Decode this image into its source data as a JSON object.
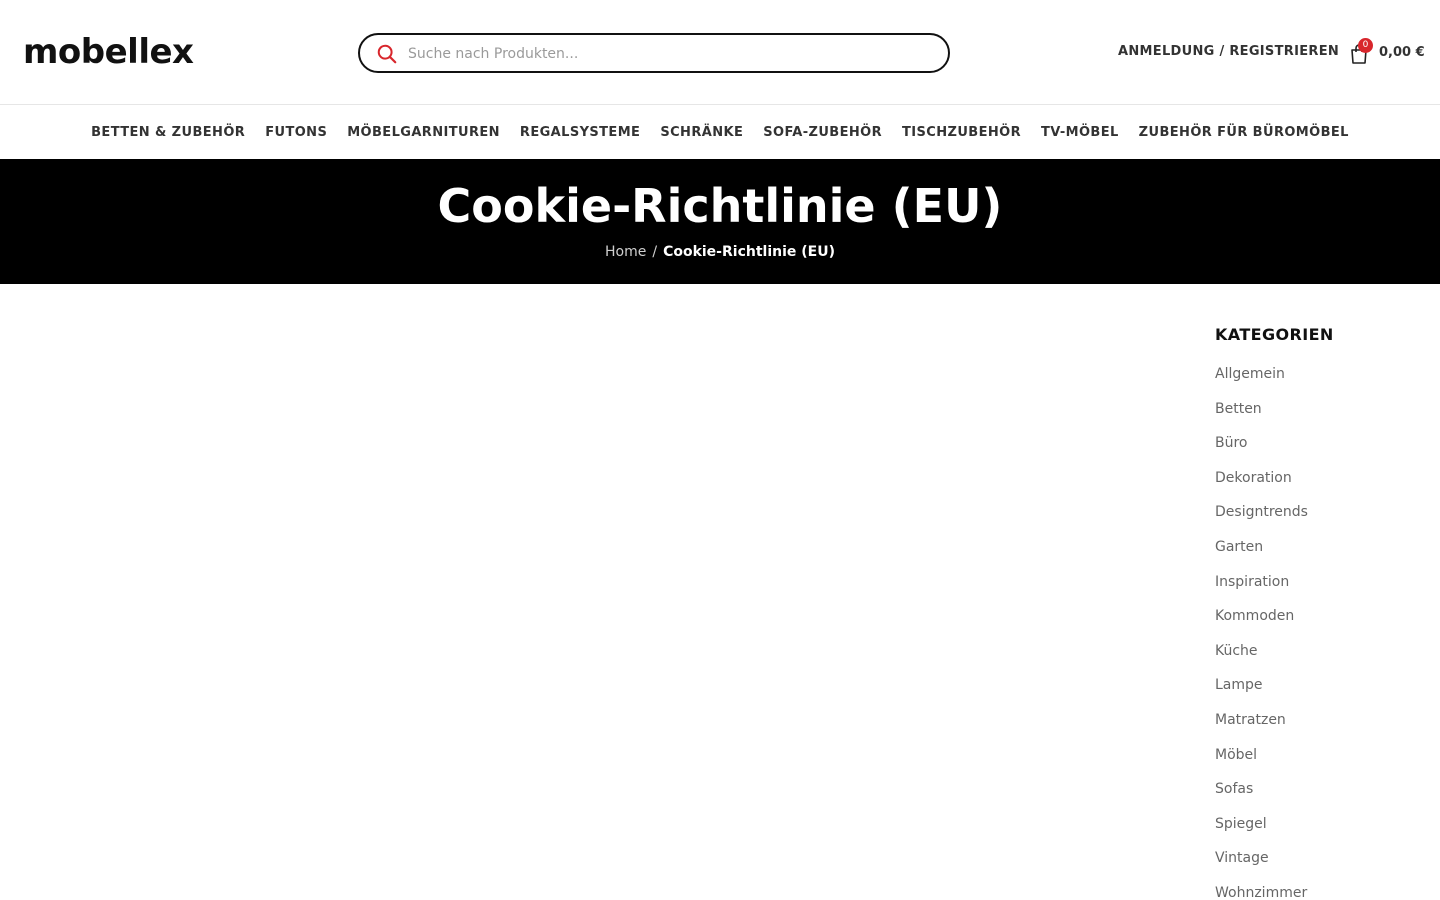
{
  "header": {
    "logo": "mobellex",
    "search_placeholder": "Suche nach Produkten...",
    "login_label": "ANMELDUNG / REGISTRIEREN",
    "cart_count": "0",
    "cart_total": "0,00 €"
  },
  "nav": {
    "items": [
      "BETTEN & ZUBEHÖR",
      "FUTONS",
      "MÖBELGARNITUREN",
      "REGALSYSTEME",
      "SCHRÄNKE",
      "SOFA-ZUBEHÖR",
      "TISCHZUBEHÖR",
      "TV-MÖBEL",
      "ZUBEHÖR FÜR BÜROMÖBEL"
    ]
  },
  "hero": {
    "title": "Cookie-Richtlinie (EU)",
    "breadcrumb_home": "Home",
    "breadcrumb_separator": "/",
    "breadcrumb_current": "Cookie-Richtlinie (EU)"
  },
  "sidebar": {
    "title": "KATEGORIEN",
    "categories": [
      "Allgemein",
      "Betten",
      "Büro",
      "Dekoration",
      "Designtrends",
      "Garten",
      "Inspiration",
      "Kommoden",
      "Küche",
      "Lampe",
      "Matratzen",
      "Möbel",
      "Sofas",
      "Spiegel",
      "Vintage",
      "Wohnzimmer"
    ]
  },
  "colors": {
    "accent": "#d8262c",
    "hero_bg": "#000000",
    "text": "#333333"
  }
}
